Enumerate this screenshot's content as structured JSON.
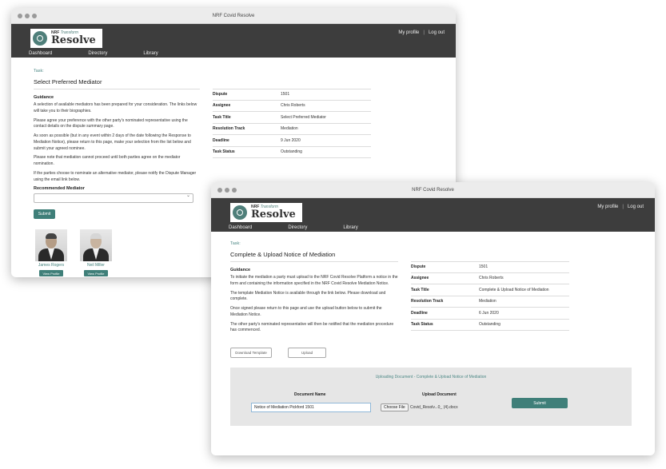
{
  "window1": {
    "title": "NRF Covid Resolve",
    "logo": {
      "small": "Transform",
      "big": "Resolve"
    },
    "top_links": {
      "profile": "My profile",
      "logout": "Log out"
    },
    "nav": [
      "Dashboard",
      "Directory",
      "Library"
    ],
    "task_label": "Task:",
    "page_title": "Select Preferred Mediator",
    "guidance_heading": "Guidance",
    "paragraphs": [
      "A selection of available mediators has been prepared for your consideration. The links below will take you to their biographies.",
      "Please agree your preference with the other party's nominated representative using the contact details on the dispute summary page.",
      "As soon as possible (but in any event within 2 days of the date following the Response to Mediation Notice), please return to this page, make your selection from the list below and submit your agreed nominee.",
      "Please note that mediation cannot proceed until both parties agree on the mediator nomination.",
      "If the parties choose to nominate an alternative mediator, please notify the Dispute Manager using the email link below."
    ],
    "recommended_label": "Recommended Mediator",
    "submit_label": "Submit",
    "mediators": [
      {
        "name": "James Rogers",
        "button": "View Profile"
      },
      {
        "name": "Neil Miller",
        "button": "View Profile"
      }
    ],
    "details": [
      {
        "key": "Dispute",
        "value": "1501"
      },
      {
        "key": "Assignee",
        "value": "Chris Roberts"
      },
      {
        "key": "Task Title",
        "value": "Select Preferred Mediator"
      },
      {
        "key": "Resolution Track",
        "value": "Mediation"
      },
      {
        "key": "Deadline",
        "value": "9 Jun 2020"
      },
      {
        "key": "Task Status",
        "value": "Outstanding"
      }
    ]
  },
  "window2": {
    "title": "NRF Covid Resolve",
    "logo": {
      "small": "Transform",
      "big": "Resolve"
    },
    "top_links": {
      "profile": "My profile",
      "logout": "Log out"
    },
    "nav": [
      "Dashboard",
      "Directory",
      "Library"
    ],
    "task_label": "Task:",
    "page_title": "Complete & Upload Notice of Mediation",
    "guidance_heading": "Guidance",
    "paragraphs": [
      "To initiate the mediation a party must upload to the NRF Covid Resolve Platform a notice in the form and containing the information specified in the NRF Covid Resolve Mediation Notice.",
      "The template Mediation Notice is available through the link below. Please download and complete.",
      "Once signed please return to this page and use the upload button below to submit the Mediation Notice.",
      "The other party's nominated representative will then be notified that the mediation procedure has commenced."
    ],
    "download_label": "Download Template",
    "upload_label": "Upload",
    "details": [
      {
        "key": "Dispute",
        "value": "1501"
      },
      {
        "key": "Assignee",
        "value": "Chris Roberts"
      },
      {
        "key": "Task Title",
        "value": "Complete & Upload Notice of Mediation"
      },
      {
        "key": "Resolution Track",
        "value": "Mediation"
      },
      {
        "key": "Deadline",
        "value": "6 Jun 2020"
      },
      {
        "key": "Task Status",
        "value": "Outstanding"
      }
    ],
    "upload_panel": {
      "title": "Uploading Document - Complete & Upload Notice of Mediation",
      "doc_name_header": "Document Name",
      "upload_doc_header": "Upload Document",
      "doc_name_value": "Notice of Mediation Pickford 1501",
      "choose_file": "Choose File",
      "file_name": "Covid_Resolv...0_ (4).docx",
      "submit_label": "Submit"
    }
  },
  "colors": {
    "accent": "#3f7f79",
    "header_bg": "#3d3d3d",
    "panel_bg": "#e6e6e6"
  }
}
